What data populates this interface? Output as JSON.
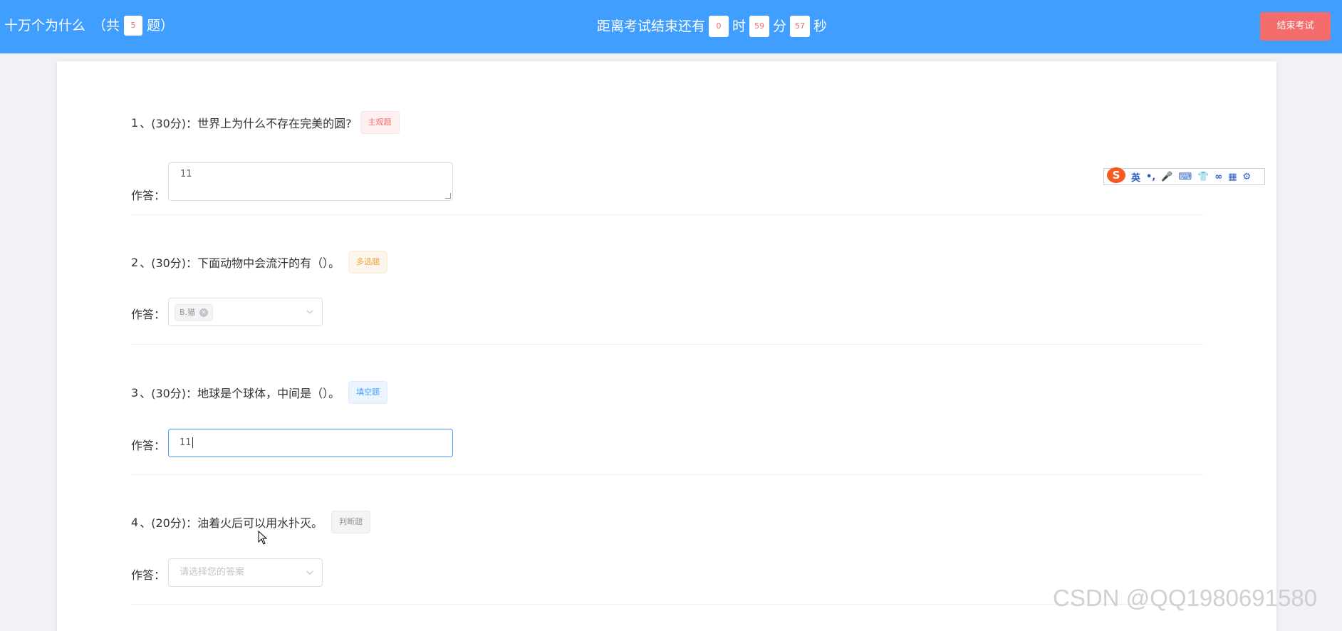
{
  "header": {
    "title": "十万个为什么",
    "total_prefix": "（共",
    "total_count": "5",
    "total_suffix": "题）",
    "countdown_label": "距离考试结束还有",
    "hours": "0",
    "hour_unit": "时",
    "minutes": "59",
    "minute_unit": "分",
    "seconds": "57",
    "second_unit": "秒",
    "end_button": "结束考试"
  },
  "answer_label": "作答：",
  "questions": [
    {
      "num": "1",
      "sep": "、",
      "score": "(30分)：",
      "text": "世界上为什么不存在完美的圆?",
      "tag": "主观题",
      "answer": "11"
    },
    {
      "num": "2",
      "sep": "、",
      "score": "(30分)：",
      "text": "下面动物中会流汗的有（）。",
      "tag": "多选题",
      "selected": "B.猫"
    },
    {
      "num": "3",
      "sep": "、",
      "score": "(30分)：",
      "text": "地球是个球体，中间是（）。",
      "tag": "填空题",
      "answer": "11"
    },
    {
      "num": "4",
      "sep": "、",
      "score": "(20分)：",
      "text": "油着火后可以用水扑灭。",
      "tag": "判断题",
      "placeholder": "请选择您的答案"
    }
  ],
  "ime_toolbar": {
    "logo": "S",
    "items": [
      "英",
      "•,",
      "🎤",
      "⌨",
      "👕",
      "∞",
      "▦",
      "⚙"
    ]
  },
  "watermark": "CSDN @QQ1980691580",
  "colors": {
    "header_bg": "#409eff",
    "danger": "#f56c6c",
    "warning": "#e6a23c",
    "primary": "#409eff",
    "info": "#909399"
  }
}
